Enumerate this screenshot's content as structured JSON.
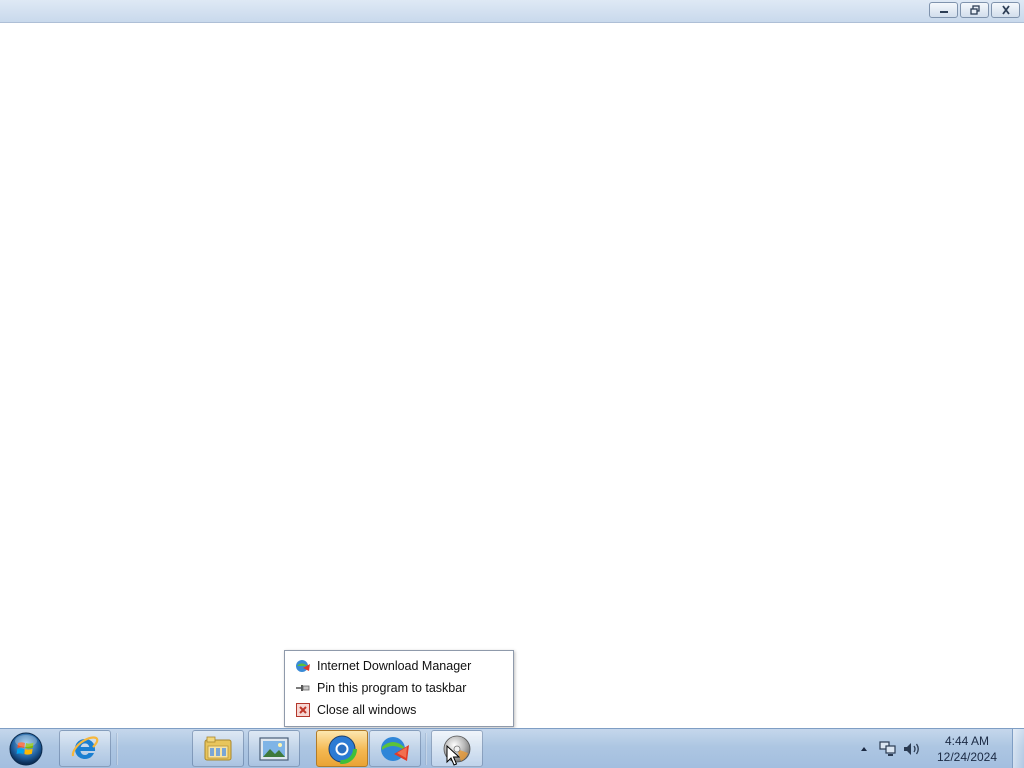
{
  "window": {
    "caption_buttons": [
      {
        "name": "minimize",
        "icon": "minimize-icon"
      },
      {
        "name": "restore",
        "icon": "restore-icon"
      },
      {
        "name": "close",
        "icon": "close-icon"
      }
    ]
  },
  "taskbar": {
    "start_icon": "windows-start-orb-icon",
    "buttons": [
      {
        "id": "internet-explorer",
        "icon": "internet-explorer-icon",
        "state": "pinned"
      },
      {
        "id": "file-explorer",
        "icon": "folder-library-icon",
        "state": "pinned"
      },
      {
        "id": "picture-viewer",
        "icon": "image-viewer-icon",
        "state": "pinned"
      },
      {
        "id": "browser-app",
        "icon": "globe-browser-icon",
        "state": "active"
      },
      {
        "id": "internet-download-manager",
        "icon": "idm-globe-arrow-icon",
        "state": "running"
      },
      {
        "id": "media-app",
        "icon": "disc-icon",
        "state": "hover"
      }
    ],
    "tray": {
      "icons": [
        "show-hidden-icons-arrow",
        "network-icon",
        "volume-icon"
      ],
      "time": "4:44 AM",
      "date": "12/24/2024"
    }
  },
  "jump_list": {
    "items": [
      {
        "label": "Internet Download Manager",
        "icon": "idm-globe-arrow-icon"
      },
      {
        "label": "Pin this program to taskbar",
        "icon": "pin-icon"
      },
      {
        "label": "Close all windows",
        "icon": "close-window-red-icon"
      }
    ]
  },
  "colors": {
    "taskbar": "#adc6e2",
    "active_button": "#f4b851",
    "titlebar": "#c9d9ec"
  }
}
